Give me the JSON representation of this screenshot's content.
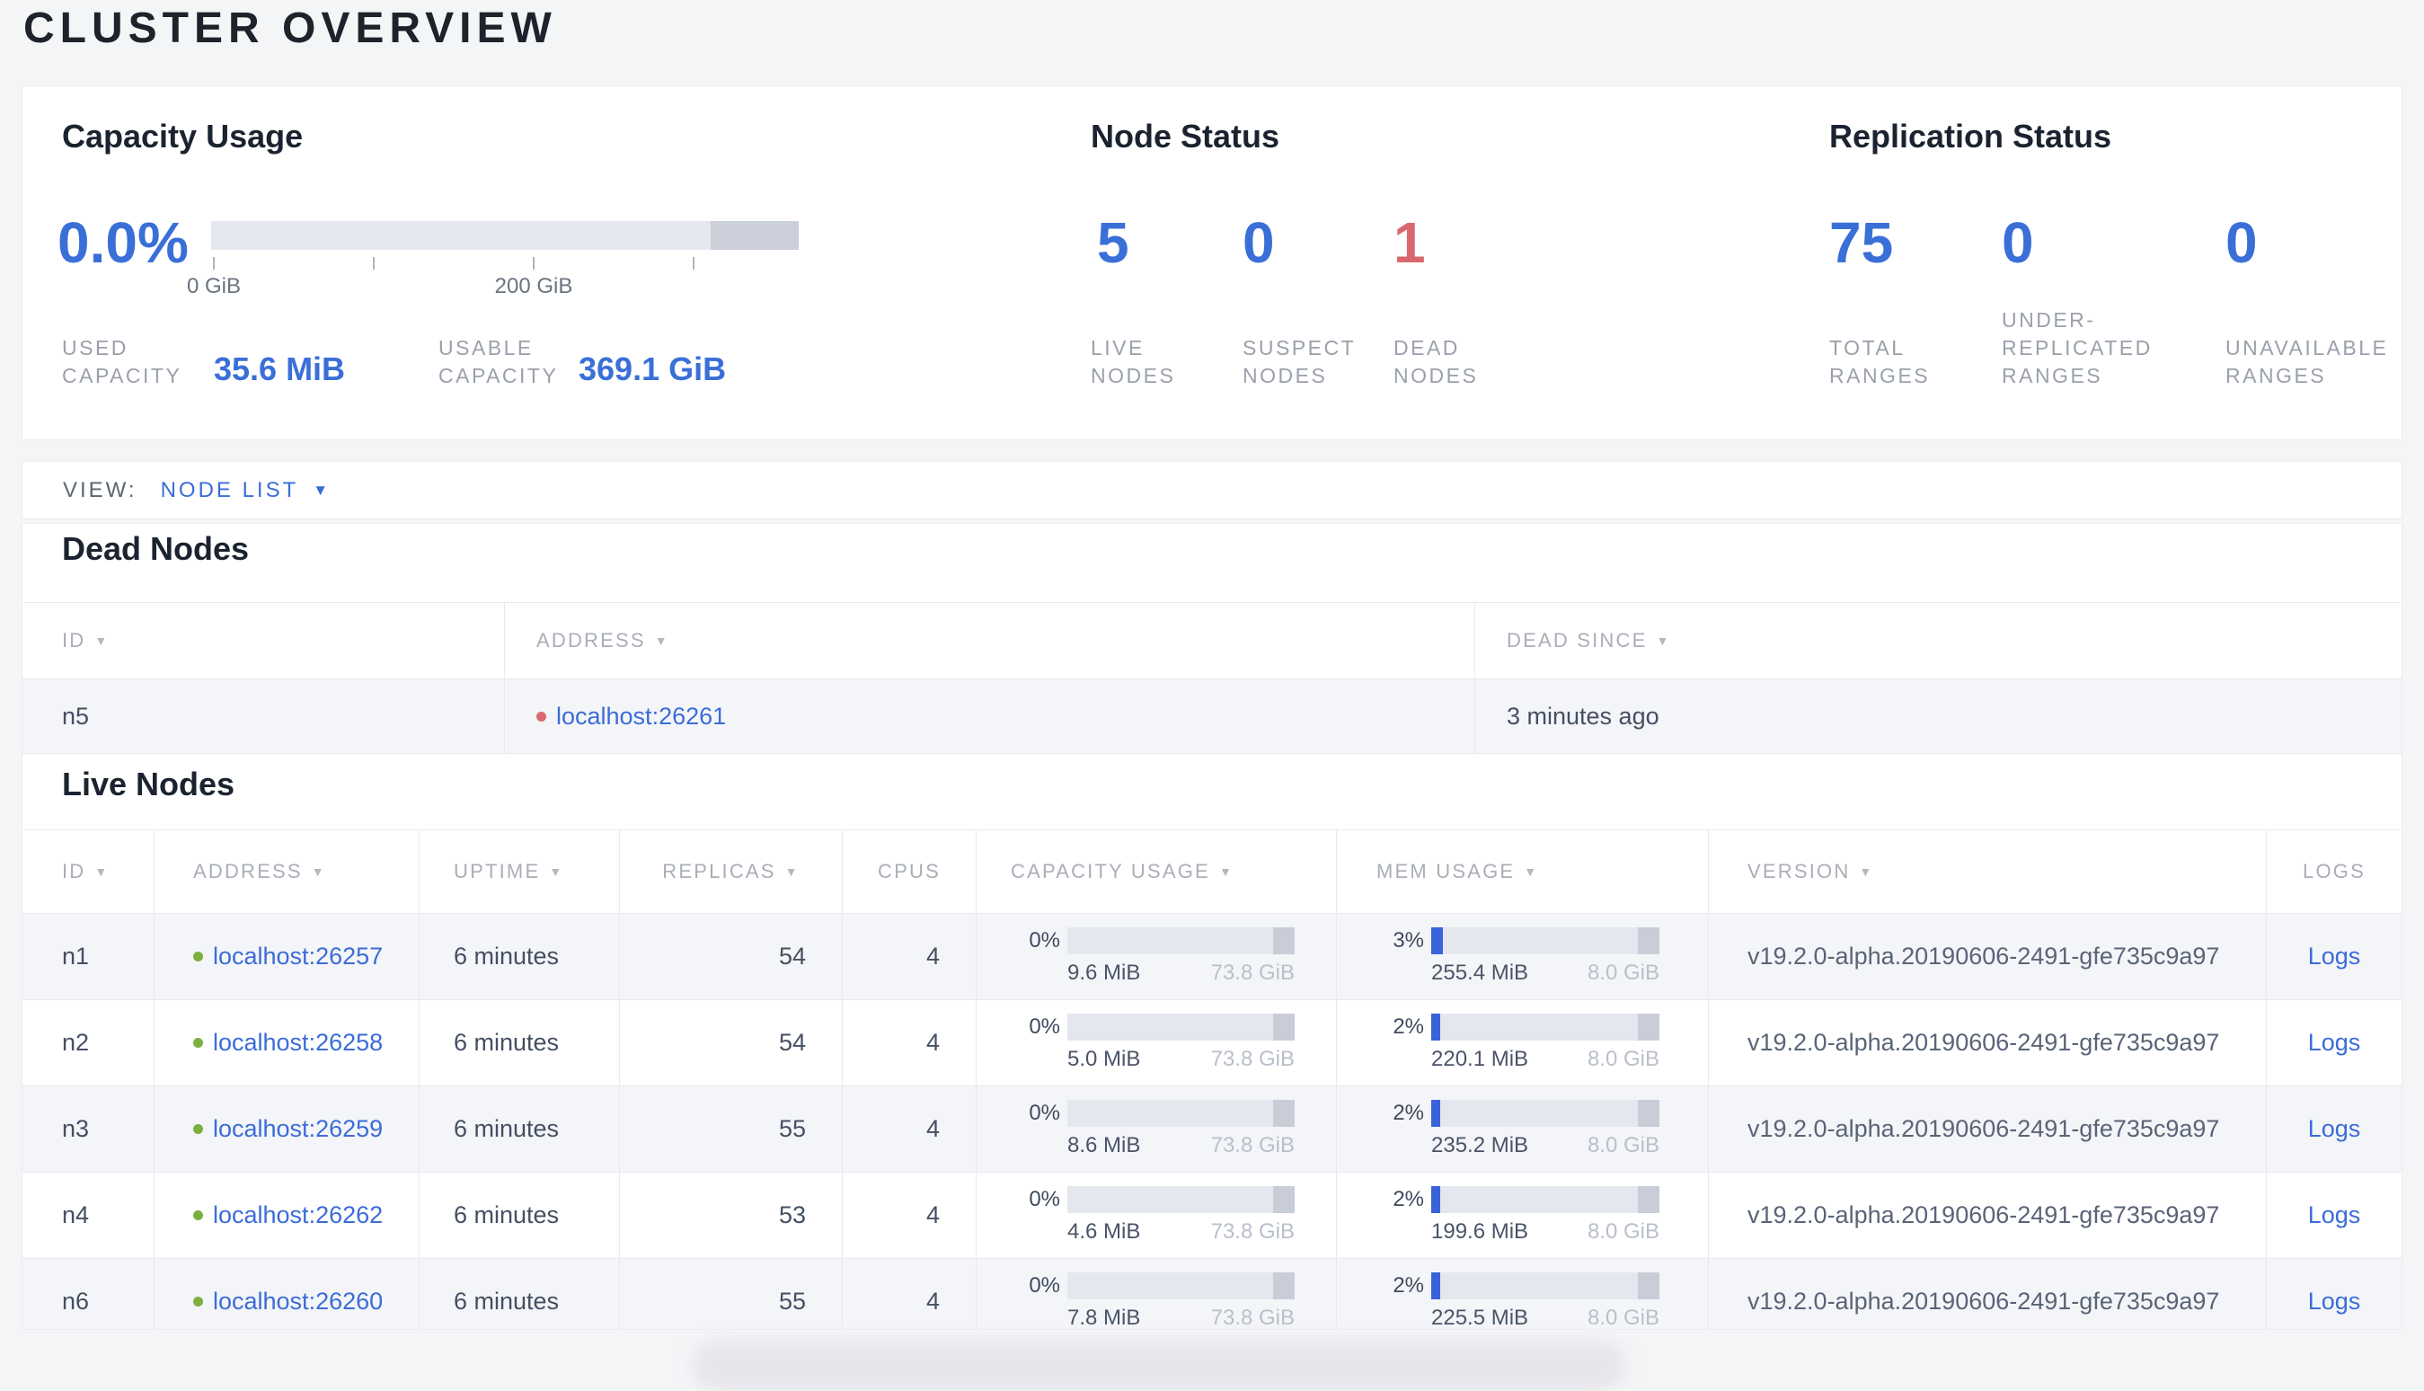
{
  "page": {
    "title": "CLUSTER OVERVIEW"
  },
  "colors": {
    "accent_blue": "#3a6fd8",
    "danger_red": "#d9686e",
    "link_blue": "#3b6cd8",
    "live_green": "#7caf3e",
    "bar_track": "#e4e7ee",
    "bar_other": "#c9cdd8"
  },
  "overview": {
    "capacity": {
      "title": "Capacity Usage",
      "percent": "0.0%",
      "bar": {
        "used_w": "0%",
        "other_w": "15%"
      },
      "axis": {
        "tick1": "0 GiB",
        "tick2": "200 GiB"
      },
      "used_label": "USED\nCAPACITY",
      "used_value": "35.6 MiB",
      "usable_label": "USABLE\nCAPACITY",
      "usable_value": "369.1 GiB"
    },
    "nodes": {
      "title": "Node Status",
      "live": {
        "value": "5",
        "label": "LIVE\nNODES"
      },
      "suspect": {
        "value": "0",
        "label": "SUSPECT\nNODES"
      },
      "dead": {
        "value": "1",
        "label": "DEAD\nNODES"
      }
    },
    "replication": {
      "title": "Replication Status",
      "total": {
        "value": "75",
        "label": "TOTAL\nRANGES"
      },
      "under": {
        "value": "0",
        "label": "UNDER-\nREPLICATED\nRANGES"
      },
      "unavailable": {
        "value": "0",
        "label": "UNAVAILABLE\nRANGES"
      }
    }
  },
  "view_bar": {
    "label": "VIEW:",
    "selected": "NODE LIST"
  },
  "dead_nodes": {
    "title": "Dead Nodes",
    "headers": {
      "id": "ID",
      "address": "ADDRESS",
      "dead_since": "DEAD SINCE"
    },
    "rows": [
      {
        "id": "n5",
        "address": "localhost:26261",
        "dead_since": "3 minutes ago"
      }
    ]
  },
  "live_nodes": {
    "title": "Live Nodes",
    "headers": {
      "id": "ID",
      "address": "ADDRESS",
      "uptime": "UPTIME",
      "replicas": "REPLICAS",
      "cpus": "CPUS",
      "capacity": "CAPACITY USAGE",
      "mem": "MEM USAGE",
      "version": "VERSION",
      "logs": "LOGS"
    },
    "logs_label": "Logs",
    "bar_other_w": "9.5%",
    "rows": [
      {
        "id": "n1",
        "address": "localhost:26257",
        "uptime": "6 minutes",
        "replicas": "54",
        "cpus": "4",
        "capacity": {
          "pct": "0%",
          "used": "9.6 MiB",
          "total": "73.8 GiB",
          "fill_w": "0%"
        },
        "mem": {
          "pct": "3%",
          "used": "255.4 MiB",
          "total": "8.0 GiB",
          "fill_w": "5%"
        },
        "version": "v19.2.0-alpha.20190606-2491-gfe735c9a97"
      },
      {
        "id": "n2",
        "address": "localhost:26258",
        "uptime": "6 minutes",
        "replicas": "54",
        "cpus": "4",
        "capacity": {
          "pct": "0%",
          "used": "5.0 MiB",
          "total": "73.8 GiB",
          "fill_w": "0%"
        },
        "mem": {
          "pct": "2%",
          "used": "220.1 MiB",
          "total": "8.0 GiB",
          "fill_w": "4%"
        },
        "version": "v19.2.0-alpha.20190606-2491-gfe735c9a97"
      },
      {
        "id": "n3",
        "address": "localhost:26259",
        "uptime": "6 minutes",
        "replicas": "55",
        "cpus": "4",
        "capacity": {
          "pct": "0%",
          "used": "8.6 MiB",
          "total": "73.8 GiB",
          "fill_w": "0%"
        },
        "mem": {
          "pct": "2%",
          "used": "235.2 MiB",
          "total": "8.0 GiB",
          "fill_w": "4%"
        },
        "version": "v19.2.0-alpha.20190606-2491-gfe735c9a97"
      },
      {
        "id": "n4",
        "address": "localhost:26262",
        "uptime": "6 minutes",
        "replicas": "53",
        "cpus": "4",
        "capacity": {
          "pct": "0%",
          "used": "4.6 MiB",
          "total": "73.8 GiB",
          "fill_w": "0%"
        },
        "mem": {
          "pct": "2%",
          "used": "199.6 MiB",
          "total": "8.0 GiB",
          "fill_w": "4%"
        },
        "version": "v19.2.0-alpha.20190606-2491-gfe735c9a97"
      },
      {
        "id": "n6",
        "address": "localhost:26260",
        "uptime": "6 minutes",
        "replicas": "55",
        "cpus": "4",
        "capacity": {
          "pct": "0%",
          "used": "7.8 MiB",
          "total": "73.8 GiB",
          "fill_w": "0%"
        },
        "mem": {
          "pct": "2%",
          "used": "225.5 MiB",
          "total": "8.0 GiB",
          "fill_w": "4%"
        },
        "version": "v19.2.0-alpha.20190606-2491-gfe735c9a97"
      }
    ]
  }
}
